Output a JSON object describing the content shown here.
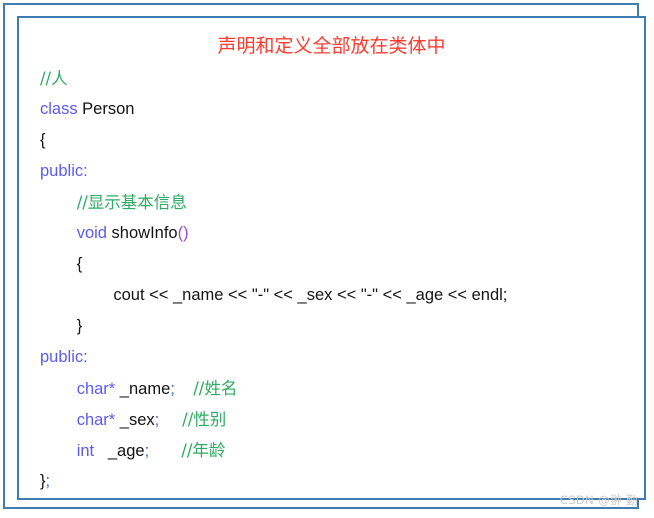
{
  "document": {
    "title": "声明和定义全部放在类体中",
    "title_color": "#ff3b30",
    "frame_color": "#3e7cb1",
    "watermark": "CSDN @翀 勤"
  },
  "code": {
    "language": "cpp",
    "colors": {
      "keyword": "#5b5bf0",
      "comment": "#2eab62",
      "punctuation": "#a04bd0",
      "semicolon": "#2f6fd0",
      "plain": "#141414"
    },
    "lines": [
      {
        "indent": 0,
        "tokens": [
          {
            "t": "//人",
            "c": "cmt"
          }
        ]
      },
      {
        "indent": 0,
        "tokens": [
          {
            "t": "class",
            "c": "kw"
          },
          {
            "t": " Person",
            "c": "plain"
          }
        ]
      },
      {
        "indent": 0,
        "tokens": [
          {
            "t": "{",
            "c": "plain"
          }
        ]
      },
      {
        "indent": 0,
        "tokens": [
          {
            "t": "public",
            "c": "kw"
          },
          {
            "t": ":",
            "c": "semi"
          }
        ]
      },
      {
        "indent": 1,
        "tokens": [
          {
            "t": "//显示基本信息",
            "c": "cmt"
          }
        ]
      },
      {
        "indent": 1,
        "tokens": [
          {
            "t": "void",
            "c": "kw"
          },
          {
            "t": " showInfo",
            "c": "plain"
          },
          {
            "t": "()",
            "c": "punc"
          }
        ]
      },
      {
        "indent": 1,
        "tokens": [
          {
            "t": "{",
            "c": "plain"
          }
        ]
      },
      {
        "indent": 2,
        "tokens": [
          {
            "t": "cout << _name << \"-\" << _sex << \"-\" << _age << endl;",
            "c": "plain"
          }
        ]
      },
      {
        "indent": 1,
        "tokens": [
          {
            "t": "}",
            "c": "plain"
          }
        ]
      },
      {
        "indent": 0,
        "tokens": [
          {
            "t": "public",
            "c": "kw"
          },
          {
            "t": ":",
            "c": "semi"
          }
        ]
      },
      {
        "indent": 1,
        "tokens": [
          {
            "t": "char*",
            "c": "kw"
          },
          {
            "t": " _name",
            "c": "plain"
          },
          {
            "t": ";",
            "c": "semi"
          },
          {
            "t": "    ",
            "c": "plain"
          },
          {
            "t": "//姓名",
            "c": "cmt"
          }
        ]
      },
      {
        "indent": 1,
        "tokens": [
          {
            "t": "char*",
            "c": "kw"
          },
          {
            "t": " _sex",
            "c": "plain"
          },
          {
            "t": ";",
            "c": "semi"
          },
          {
            "t": "     ",
            "c": "plain"
          },
          {
            "t": "//性别",
            "c": "cmt"
          }
        ]
      },
      {
        "indent": 1,
        "tokens": [
          {
            "t": "int",
            "c": "kw"
          },
          {
            "t": "   _age",
            "c": "plain"
          },
          {
            "t": ";",
            "c": "semi"
          },
          {
            "t": "       ",
            "c": "plain"
          },
          {
            "t": "//年龄",
            "c": "cmt"
          }
        ]
      },
      {
        "indent": 0,
        "tokens": [
          {
            "t": "}",
            "c": "plain"
          },
          {
            "t": ";",
            "c": "semi"
          }
        ]
      }
    ]
  }
}
